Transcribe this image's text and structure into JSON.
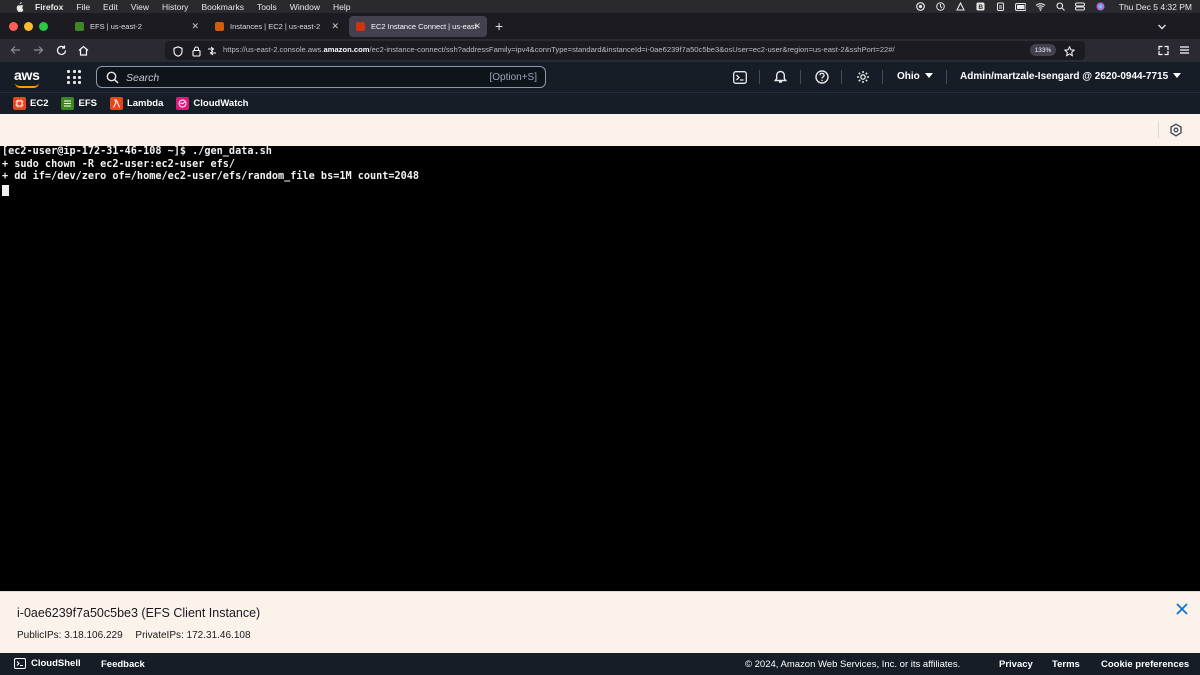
{
  "menubar": {
    "app": "Firefox",
    "items": [
      "File",
      "Edit",
      "View",
      "History",
      "Bookmarks",
      "Tools",
      "Window",
      "Help"
    ],
    "clock": "Thu Dec 5  4:32 PM"
  },
  "tabs": [
    {
      "label": "EFS | us-east-2",
      "favicon_color": "#3f8624",
      "active": false
    },
    {
      "label": "Instances | EC2 | us-east-2",
      "favicon_color": "#d45b07",
      "active": false
    },
    {
      "label": "EC2 Instance Connect | us-east-",
      "favicon_color": "#d13212",
      "active": true
    }
  ],
  "urlbar": {
    "url_prefix": "https://us-east-2.console.aws.",
    "url_domain": "amazon.com",
    "url_suffix": "/ec2-instance-connect/ssh?addressFamily=ipv4&connType=standard&instanceId=i-0ae6239f7a50c5be3&osUser=ec2-user&region=us-east-2&sshPort=22#/",
    "zoom": "133%"
  },
  "aws_header": {
    "logo": "aws",
    "search_placeholder": "Search",
    "search_shortcut": "[Option+S]",
    "region": "Ohio",
    "account": "Admin/martzale-Isengard @ 2620-0944-7715"
  },
  "favorites": [
    {
      "label": "EC2",
      "color": "#e7461a"
    },
    {
      "label": "EFS",
      "color": "#3f8624"
    },
    {
      "label": "Lambda",
      "color": "#e7461a"
    },
    {
      "label": "CloudWatch",
      "color": "#e7157b"
    }
  ],
  "terminal": {
    "lines": [
      "[ec2-user@ip-172-31-46-108 ~]$ ./gen_data.sh",
      "+ sudo chown -R ec2-user:ec2-user efs/",
      "+ dd if=/dev/zero of=/home/ec2-user/efs/random_file bs=1M count=2048"
    ]
  },
  "instance": {
    "title": "i-0ae6239f7a50c5be3 (EFS Client Instance)",
    "public_ips": "PublicIPs: 3.18.106.229",
    "private_ips": "PrivateIPs: 172.31.46.108"
  },
  "footer": {
    "cloudshell": "CloudShell",
    "feedback": "Feedback",
    "copyright": "© 2024, Amazon Web Services, Inc. or its affiliates.",
    "privacy": "Privacy",
    "terms": "Terms",
    "cookies": "Cookie preferences"
  }
}
